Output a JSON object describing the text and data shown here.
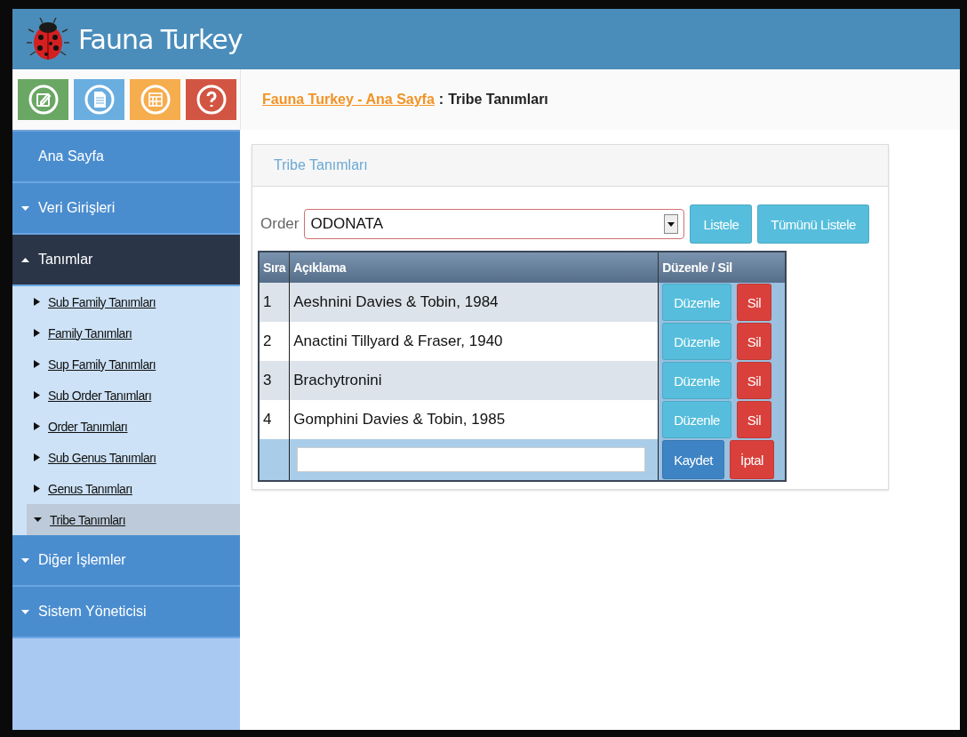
{
  "header": {
    "title": "Fauna Turkey"
  },
  "toolbar": {
    "buttons": [
      {
        "kind": "edit",
        "color": "#6aa764"
      },
      {
        "kind": "document",
        "color": "#6aaee0"
      },
      {
        "kind": "calendar",
        "color": "#f6ad4e"
      },
      {
        "kind": "help",
        "color": "#d25543"
      }
    ]
  },
  "breadcrumb": {
    "link": "Fauna Turkey - Ana Sayfa",
    "separator": ":",
    "current": "Tribe Tanımları"
  },
  "sidebar": {
    "items": [
      {
        "label": "Ana Sayfa",
        "kind": "link"
      },
      {
        "label": "Veri Girişleri",
        "kind": "group",
        "expanded": false
      },
      {
        "label": "Tanımlar",
        "kind": "group",
        "expanded": true,
        "children": [
          {
            "label": "Sub Family Tanımları",
            "selected": false
          },
          {
            "label": "Family Tanımları",
            "selected": false
          },
          {
            "label": "Sup Family Tanımları",
            "selected": false
          },
          {
            "label": "Sub Order Tanımları",
            "selected": false
          },
          {
            "label": "Order Tanımları",
            "selected": false
          },
          {
            "label": "Sub Genus Tanımları",
            "selected": false
          },
          {
            "label": "Genus Tanımları",
            "selected": false
          },
          {
            "label": "Tribe Tanımları",
            "selected": true
          }
        ]
      },
      {
        "label": "Diğer İşlemler",
        "kind": "group",
        "expanded": false
      },
      {
        "label": "Sistem Yöneticisi",
        "kind": "group",
        "expanded": false
      }
    ]
  },
  "panel": {
    "title": "Tribe Tanımları",
    "filter": {
      "label": "Order",
      "value": "ODONATA"
    },
    "buttons": [
      "Listele",
      "Tümünü Listele"
    ],
    "table": {
      "columns": [
        "Sıra",
        "Açıklama",
        "Düzenle / Sil"
      ],
      "rows": [
        {
          "no": "1",
          "description": "Aeshnini Davies & Tobin, 1984",
          "edit": "Düzenle",
          "delete": "Sil"
        },
        {
          "no": "2",
          "description": "Anactini Tillyard & Fraser, 1940",
          "edit": "Düzenle",
          "delete": "Sil"
        },
        {
          "no": "3",
          "description": "Brachytronini",
          "edit": "Düzenle",
          "delete": "Sil"
        },
        {
          "no": "4",
          "description": "Gomphini Davies & Tobin, 1985",
          "edit": "Düzenle",
          "delete": "Sil"
        }
      ],
      "new_row": {
        "save": "Kaydet",
        "cancel": "İptal"
      }
    }
  }
}
